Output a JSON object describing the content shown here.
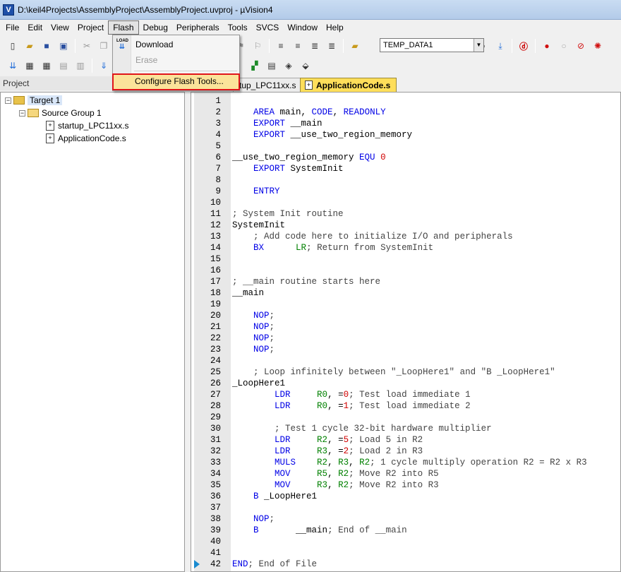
{
  "window": {
    "title": "D:\\keil4Projects\\AssemblyProject\\AssemblyProject.uvproj - µVision4"
  },
  "menu": [
    "File",
    "Edit",
    "View",
    "Project",
    "Flash",
    "Debug",
    "Peripherals",
    "Tools",
    "SVCS",
    "Window",
    "Help"
  ],
  "flash_menu": {
    "download": "Download",
    "erase": "Erase",
    "configure": "Configure Flash Tools...",
    "load_icon_text": "LOAD"
  },
  "toolbar": {
    "target_combo": "TEMP_DATA1"
  },
  "project": {
    "header": "Project",
    "target": "Target 1",
    "group": "Source Group 1",
    "files": [
      "startup_LPC11xx.s",
      "ApplicationCode.s"
    ]
  },
  "tabs": {
    "inactive": "tup_LPC11xx.s",
    "active": "ApplicationCode.s"
  },
  "colors": {
    "keyword": "#0000e6",
    "number": "#d00000",
    "register": "#008000",
    "active_tab": "#ffde5a"
  },
  "code_lines": [
    "",
    "    AREA main, CODE, READONLY",
    "    EXPORT __main",
    "    EXPORT __use_two_region_memory",
    "",
    "__use_two_region_memory EQU 0",
    "    EXPORT SystemInit",
    "",
    "    ENTRY",
    "",
    "; System Init routine",
    "SystemInit",
    "    ; Add code here to initialize I/O and peripherals",
    "    BX      LR; Return from SystemInit",
    "",
    "",
    "; __main routine starts here",
    "__main",
    "",
    "    NOP;",
    "    NOP;",
    "    NOP;",
    "    NOP;",
    "",
    "    ; Loop infinitely between \"_LoopHere1\" and \"B _LoopHere1\"",
    "_LoopHere1",
    "        LDR     R0, =0; Test load immediate 1",
    "        LDR     R0, =1; Test load immediate 2",
    "",
    "        ; Test 1 cycle 32-bit hardware multiplier",
    "        LDR     R2, =5; Load 5 in R2",
    "        LDR     R3, =2; Load 2 in R3",
    "        MULS    R2, R3, R2; 1 cycle multiply operation R2 = R2 x R3",
    "        MOV     R5, R2; Move R2 into R5",
    "        MOV     R3, R2; Move R2 into R3",
    "    B _LoopHere1",
    "",
    "    NOP;",
    "    B       __main; End of __main",
    "",
    "",
    "END; End of File"
  ]
}
